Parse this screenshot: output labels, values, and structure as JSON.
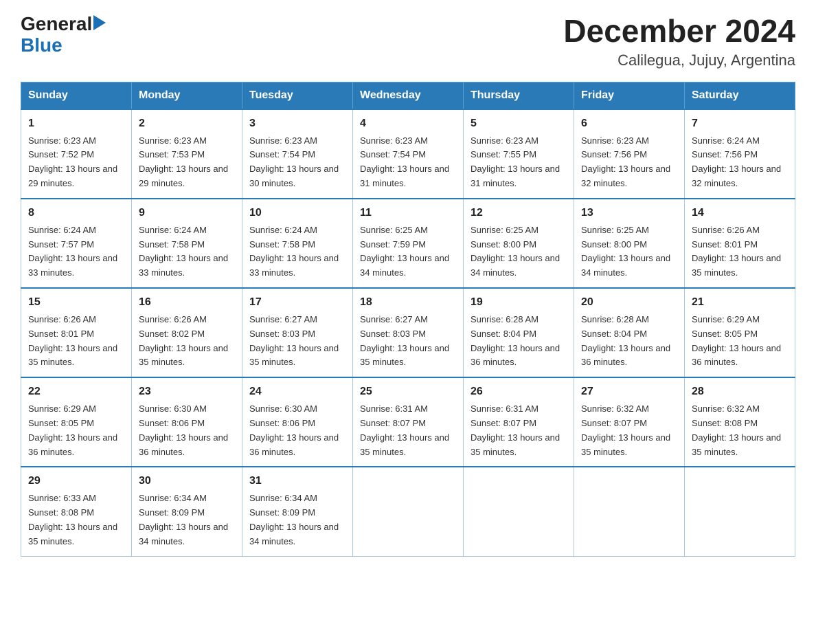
{
  "logo": {
    "general": "General",
    "blue": "Blue",
    "arrow": "▶"
  },
  "title": "December 2024",
  "subtitle": "Calilegua, Jujuy, Argentina",
  "days": [
    "Sunday",
    "Monday",
    "Tuesday",
    "Wednesday",
    "Thursday",
    "Friday",
    "Saturday"
  ],
  "weeks": [
    [
      {
        "num": "1",
        "sunrise": "6:23 AM",
        "sunset": "7:52 PM",
        "daylight": "13 hours and 29 minutes."
      },
      {
        "num": "2",
        "sunrise": "6:23 AM",
        "sunset": "7:53 PM",
        "daylight": "13 hours and 29 minutes."
      },
      {
        "num": "3",
        "sunrise": "6:23 AM",
        "sunset": "7:54 PM",
        "daylight": "13 hours and 30 minutes."
      },
      {
        "num": "4",
        "sunrise": "6:23 AM",
        "sunset": "7:54 PM",
        "daylight": "13 hours and 31 minutes."
      },
      {
        "num": "5",
        "sunrise": "6:23 AM",
        "sunset": "7:55 PM",
        "daylight": "13 hours and 31 minutes."
      },
      {
        "num": "6",
        "sunrise": "6:23 AM",
        "sunset": "7:56 PM",
        "daylight": "13 hours and 32 minutes."
      },
      {
        "num": "7",
        "sunrise": "6:24 AM",
        "sunset": "7:56 PM",
        "daylight": "13 hours and 32 minutes."
      }
    ],
    [
      {
        "num": "8",
        "sunrise": "6:24 AM",
        "sunset": "7:57 PM",
        "daylight": "13 hours and 33 minutes."
      },
      {
        "num": "9",
        "sunrise": "6:24 AM",
        "sunset": "7:58 PM",
        "daylight": "13 hours and 33 minutes."
      },
      {
        "num": "10",
        "sunrise": "6:24 AM",
        "sunset": "7:58 PM",
        "daylight": "13 hours and 33 minutes."
      },
      {
        "num": "11",
        "sunrise": "6:25 AM",
        "sunset": "7:59 PM",
        "daylight": "13 hours and 34 minutes."
      },
      {
        "num": "12",
        "sunrise": "6:25 AM",
        "sunset": "8:00 PM",
        "daylight": "13 hours and 34 minutes."
      },
      {
        "num": "13",
        "sunrise": "6:25 AM",
        "sunset": "8:00 PM",
        "daylight": "13 hours and 34 minutes."
      },
      {
        "num": "14",
        "sunrise": "6:26 AM",
        "sunset": "8:01 PM",
        "daylight": "13 hours and 35 minutes."
      }
    ],
    [
      {
        "num": "15",
        "sunrise": "6:26 AM",
        "sunset": "8:01 PM",
        "daylight": "13 hours and 35 minutes."
      },
      {
        "num": "16",
        "sunrise": "6:26 AM",
        "sunset": "8:02 PM",
        "daylight": "13 hours and 35 minutes."
      },
      {
        "num": "17",
        "sunrise": "6:27 AM",
        "sunset": "8:03 PM",
        "daylight": "13 hours and 35 minutes."
      },
      {
        "num": "18",
        "sunrise": "6:27 AM",
        "sunset": "8:03 PM",
        "daylight": "13 hours and 35 minutes."
      },
      {
        "num": "19",
        "sunrise": "6:28 AM",
        "sunset": "8:04 PM",
        "daylight": "13 hours and 36 minutes."
      },
      {
        "num": "20",
        "sunrise": "6:28 AM",
        "sunset": "8:04 PM",
        "daylight": "13 hours and 36 minutes."
      },
      {
        "num": "21",
        "sunrise": "6:29 AM",
        "sunset": "8:05 PM",
        "daylight": "13 hours and 36 minutes."
      }
    ],
    [
      {
        "num": "22",
        "sunrise": "6:29 AM",
        "sunset": "8:05 PM",
        "daylight": "13 hours and 36 minutes."
      },
      {
        "num": "23",
        "sunrise": "6:30 AM",
        "sunset": "8:06 PM",
        "daylight": "13 hours and 36 minutes."
      },
      {
        "num": "24",
        "sunrise": "6:30 AM",
        "sunset": "8:06 PM",
        "daylight": "13 hours and 36 minutes."
      },
      {
        "num": "25",
        "sunrise": "6:31 AM",
        "sunset": "8:07 PM",
        "daylight": "13 hours and 35 minutes."
      },
      {
        "num": "26",
        "sunrise": "6:31 AM",
        "sunset": "8:07 PM",
        "daylight": "13 hours and 35 minutes."
      },
      {
        "num": "27",
        "sunrise": "6:32 AM",
        "sunset": "8:07 PM",
        "daylight": "13 hours and 35 minutes."
      },
      {
        "num": "28",
        "sunrise": "6:32 AM",
        "sunset": "8:08 PM",
        "daylight": "13 hours and 35 minutes."
      }
    ],
    [
      {
        "num": "29",
        "sunrise": "6:33 AM",
        "sunset": "8:08 PM",
        "daylight": "13 hours and 35 minutes."
      },
      {
        "num": "30",
        "sunrise": "6:34 AM",
        "sunset": "8:09 PM",
        "daylight": "13 hours and 34 minutes."
      },
      {
        "num": "31",
        "sunrise": "6:34 AM",
        "sunset": "8:09 PM",
        "daylight": "13 hours and 34 minutes."
      },
      null,
      null,
      null,
      null
    ]
  ]
}
